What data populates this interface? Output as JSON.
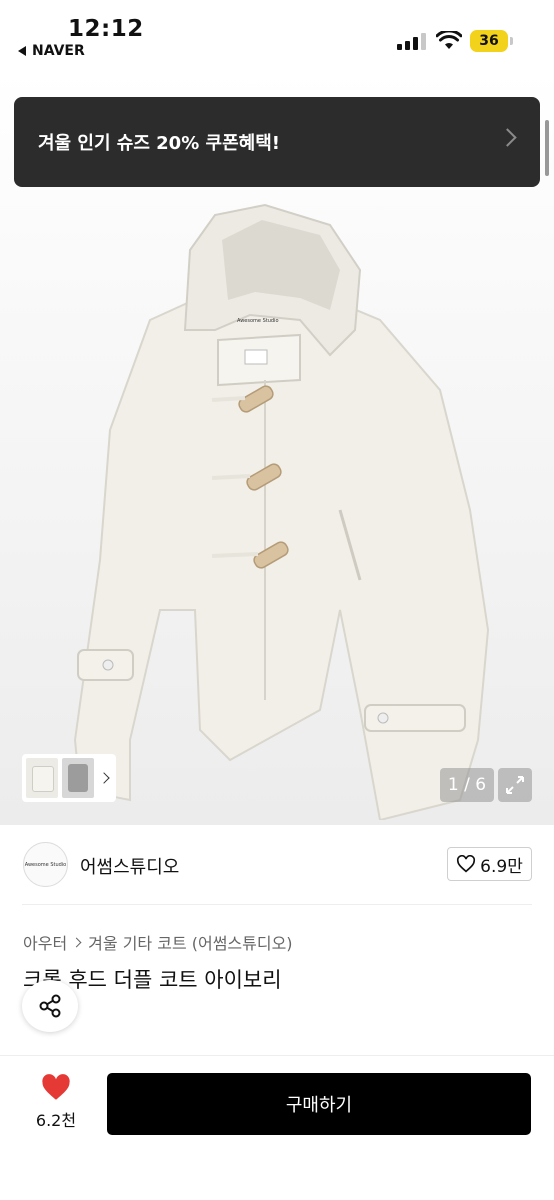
{
  "status_bar": {
    "time": "12:12",
    "back_app": "NAVER",
    "battery": "36"
  },
  "banner": {
    "text": "겨울 인기 슈즈 20% 쿠폰혜택!"
  },
  "gallery": {
    "counter": "1 / 6",
    "label_on_coat": "Awesome Studio"
  },
  "seller": {
    "logo_text": "Awesome Studio",
    "name": "어썸스튜디오",
    "likes": "6.9만"
  },
  "product": {
    "breadcrumb": [
      "아우터",
      "겨울 기타 코트 (어썸스튜디오)"
    ],
    "title": "크롭 후드 더플 코트 아이보리"
  },
  "bottom_bar": {
    "favorite_count": "6.2천",
    "buy_label": "구매하기"
  },
  "colors": {
    "banner_bg": "#2c2c2c",
    "buy_bg": "#000000",
    "heart": "#e53935",
    "battery": "#f2d21a"
  }
}
